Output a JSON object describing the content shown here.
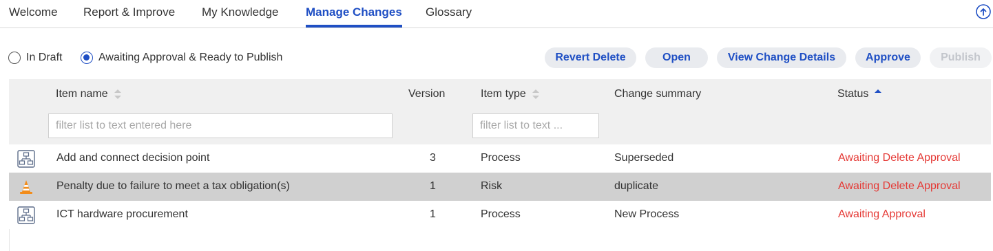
{
  "tabs": [
    {
      "label": "Welcome"
    },
    {
      "label": "Report & Improve"
    },
    {
      "label": "My Knowledge"
    },
    {
      "label": "Manage Changes",
      "active": true
    },
    {
      "label": "Glossary"
    }
  ],
  "filters": {
    "in_draft": "In Draft",
    "awaiting": "Awaiting Approval & Ready to Publish",
    "selected": "awaiting"
  },
  "toolbar": {
    "revert_delete": "Revert Delete",
    "open": "Open",
    "view_change_details": "View Change Details",
    "approve": "Approve",
    "publish": "Publish"
  },
  "table": {
    "columns": {
      "item_name": "Item name",
      "version": "Version",
      "item_type": "Item type",
      "change_summary": "Change summary",
      "status": "Status"
    },
    "filter_placeholders": {
      "item_name": "filter list to text entered here",
      "item_type": "filter list to text ..."
    },
    "sort": {
      "column": "status",
      "direction": "ascending"
    },
    "rows": [
      {
        "icon": "process-icon",
        "name": "Add and connect decision point",
        "version": "3",
        "type": "Process",
        "summary": "Superseded",
        "status": "Awaiting Delete Approval"
      },
      {
        "icon": "risk-cone-icon",
        "name": "Penalty due to failure to meet a tax obligation(s)",
        "version": "1",
        "type": "Risk",
        "summary": "duplicate",
        "status": "Awaiting Delete Approval",
        "selected": true
      },
      {
        "icon": "process-icon",
        "name": "ICT hardware procurement",
        "version": "1",
        "type": "Process",
        "summary": "New Process",
        "status": "Awaiting Approval"
      }
    ]
  },
  "colors": {
    "accent": "#1f4fc4",
    "status_red": "#e53935",
    "selected_row": "#d0d0d0",
    "header_bg": "#f0f0f0",
    "risk_orange": "#f28c1a"
  }
}
